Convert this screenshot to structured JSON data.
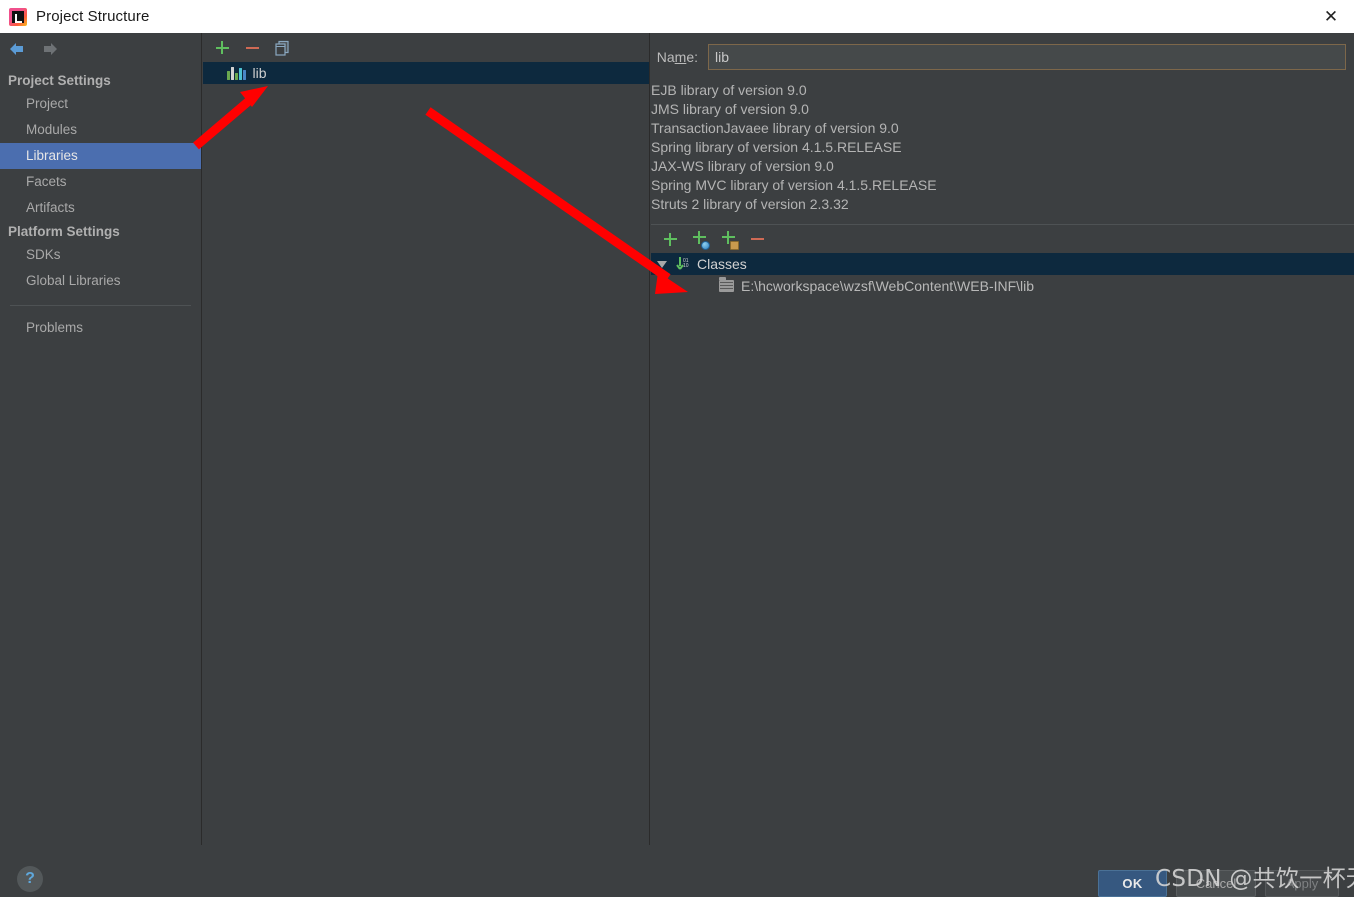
{
  "window": {
    "title": "Project Structure",
    "app_icon": "intellij-idea-icon",
    "close_label": "✕"
  },
  "sidebar": {
    "nav": {
      "back": "back-arrow",
      "forward": "forward-arrow"
    },
    "groups": [
      {
        "label": "Project Settings",
        "items": [
          {
            "label": "Project",
            "selected": false
          },
          {
            "label": "Modules",
            "selected": false
          },
          {
            "label": "Libraries",
            "selected": true
          },
          {
            "label": "Facets",
            "selected": false
          },
          {
            "label": "Artifacts",
            "selected": false
          }
        ]
      },
      {
        "label": "Platform Settings",
        "items": [
          {
            "label": "SDKs",
            "selected": false
          },
          {
            "label": "Global Libraries",
            "selected": false
          }
        ]
      }
    ],
    "problems": {
      "label": "Problems"
    }
  },
  "middle": {
    "toolbar": [
      {
        "name": "add-library-button",
        "icon": "plus-icon",
        "label": "+"
      },
      {
        "name": "remove-library-button",
        "icon": "minus-icon",
        "label": "−"
      },
      {
        "name": "copy-library-button",
        "icon": "copy-icon",
        "label": "copy"
      }
    ],
    "items": [
      {
        "label": "lib",
        "icon": "library-icon",
        "selected": true
      }
    ]
  },
  "right": {
    "name_field": {
      "label_pre": "Na",
      "label_mnemonic": "m",
      "label_post": "e:",
      "value": "lib"
    },
    "descriptions": [
      "EJB library of version 9.0",
      "JMS library of version 9.0",
      "TransactionJavaee library of version 9.0",
      "Spring library of version 4.1.5.RELEASE",
      "JAX-WS library of version 9.0",
      "Spring MVC library of version 4.1.5.RELEASE",
      "Struts 2 library of version 2.3.32"
    ],
    "roots_toolbar": [
      {
        "name": "add-root-button",
        "icon": "plus-icon"
      },
      {
        "name": "add-root-from-url-button",
        "icon": "plus-globe-icon"
      },
      {
        "name": "attach-jar-directories-button",
        "icon": "plus-archive-icon"
      },
      {
        "name": "remove-root-button",
        "icon": "minus-icon"
      }
    ],
    "tree": {
      "root": {
        "label": "Classes",
        "icon": "classes-icon",
        "expanded": true,
        "selected": true
      },
      "children": [
        {
          "label": "E:\\hcworkspace\\wzsf\\WebContent\\WEB-INF\\lib",
          "icon": "folder-icon"
        }
      ]
    }
  },
  "footer": {
    "help": "?",
    "ok": "OK",
    "cancel": "Cancel",
    "apply": "Apply"
  },
  "watermark": "CSDN @共饮一杯无",
  "colors": {
    "background": "#3c3f41",
    "selection_blue": "#4b6eaf",
    "tree_selection": "#0d293e",
    "accent_green": "#5fbf5f",
    "accent_red": "#cf6a55",
    "annotation_red": "#ff0000",
    "ok_button": "#365880"
  }
}
